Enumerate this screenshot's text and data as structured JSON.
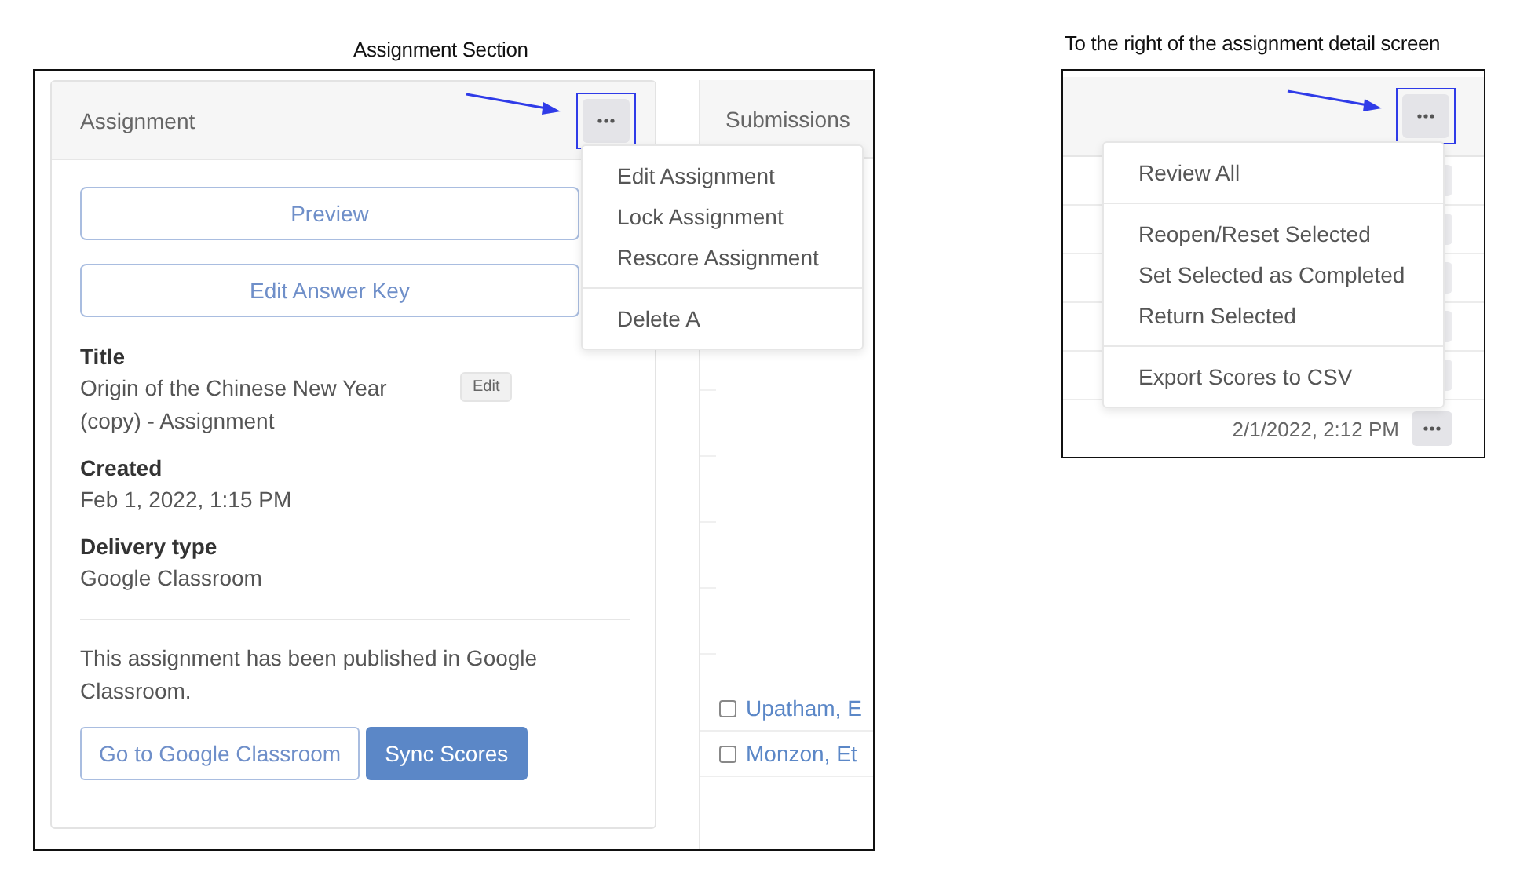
{
  "assignment_section": {
    "caption": "Assignment Section",
    "card": {
      "title": "Assignment",
      "buttons": [
        "Preview",
        "Edit Answer Key"
      ],
      "fields": [
        {
          "label": "Title",
          "value": "Origin of the Chinese New Year (copy) - Assignment",
          "action": "Edit"
        },
        {
          "label": "Created",
          "value": "Feb 1, 2022, 1:15 PM"
        },
        {
          "label": "Delivery type",
          "value": "Google Classroom"
        }
      ],
      "notice": "This assignment has been published in Google Classroom.",
      "actions": [
        {
          "label": "Go to Google Classroom",
          "kind": "outline"
        },
        {
          "label": "Sync Scores",
          "kind": "primary"
        }
      ]
    },
    "menu": [
      [
        "Edit Assignment",
        "Lock Assignment",
        "Rescore Assignment"
      ],
      [
        "Delete A"
      ]
    ],
    "submissions": {
      "title": "Submissions",
      "rows": [
        {
          "name": "Upatham, E",
          "checked": false
        },
        {
          "name": "Monzon, Et",
          "checked": false
        }
      ]
    }
  },
  "right_section": {
    "caption": "To the right of the assignment detail screen",
    "menu": [
      [
        "Review All"
      ],
      [
        "Reopen/Reset Selected",
        "Set Selected as Completed",
        "Return Selected"
      ],
      [
        "Export Scores to CSV"
      ]
    ],
    "last_row_date": "2/1/2022, 2:12 PM"
  }
}
